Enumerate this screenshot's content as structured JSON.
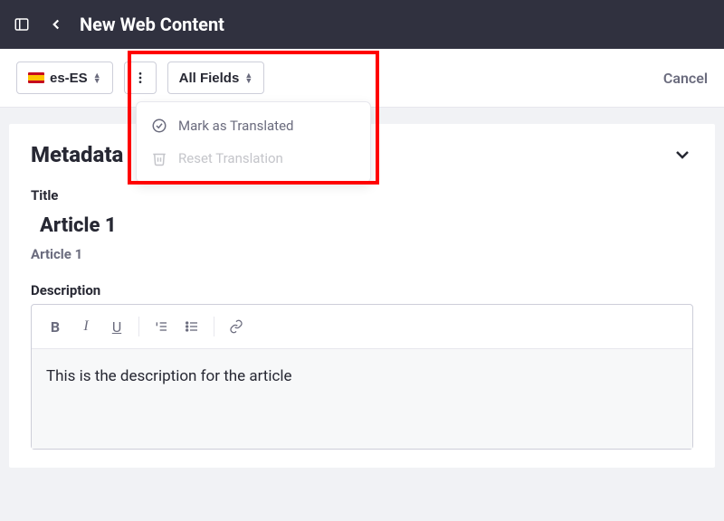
{
  "header": {
    "title": "New Web Content"
  },
  "toolbar": {
    "locale_label": "es-ES",
    "filter_label": "All Fields",
    "cancel_label": "Cancel"
  },
  "dropdown": {
    "mark_translated": "Mark as Translated",
    "reset_translation": "Reset Translation"
  },
  "section": {
    "title": "Metadata"
  },
  "fields": {
    "title_label": "Title",
    "title_value": "Article 1",
    "title_reference": "Article 1",
    "description_label": "Description",
    "description_value": "This is the description for the article"
  }
}
